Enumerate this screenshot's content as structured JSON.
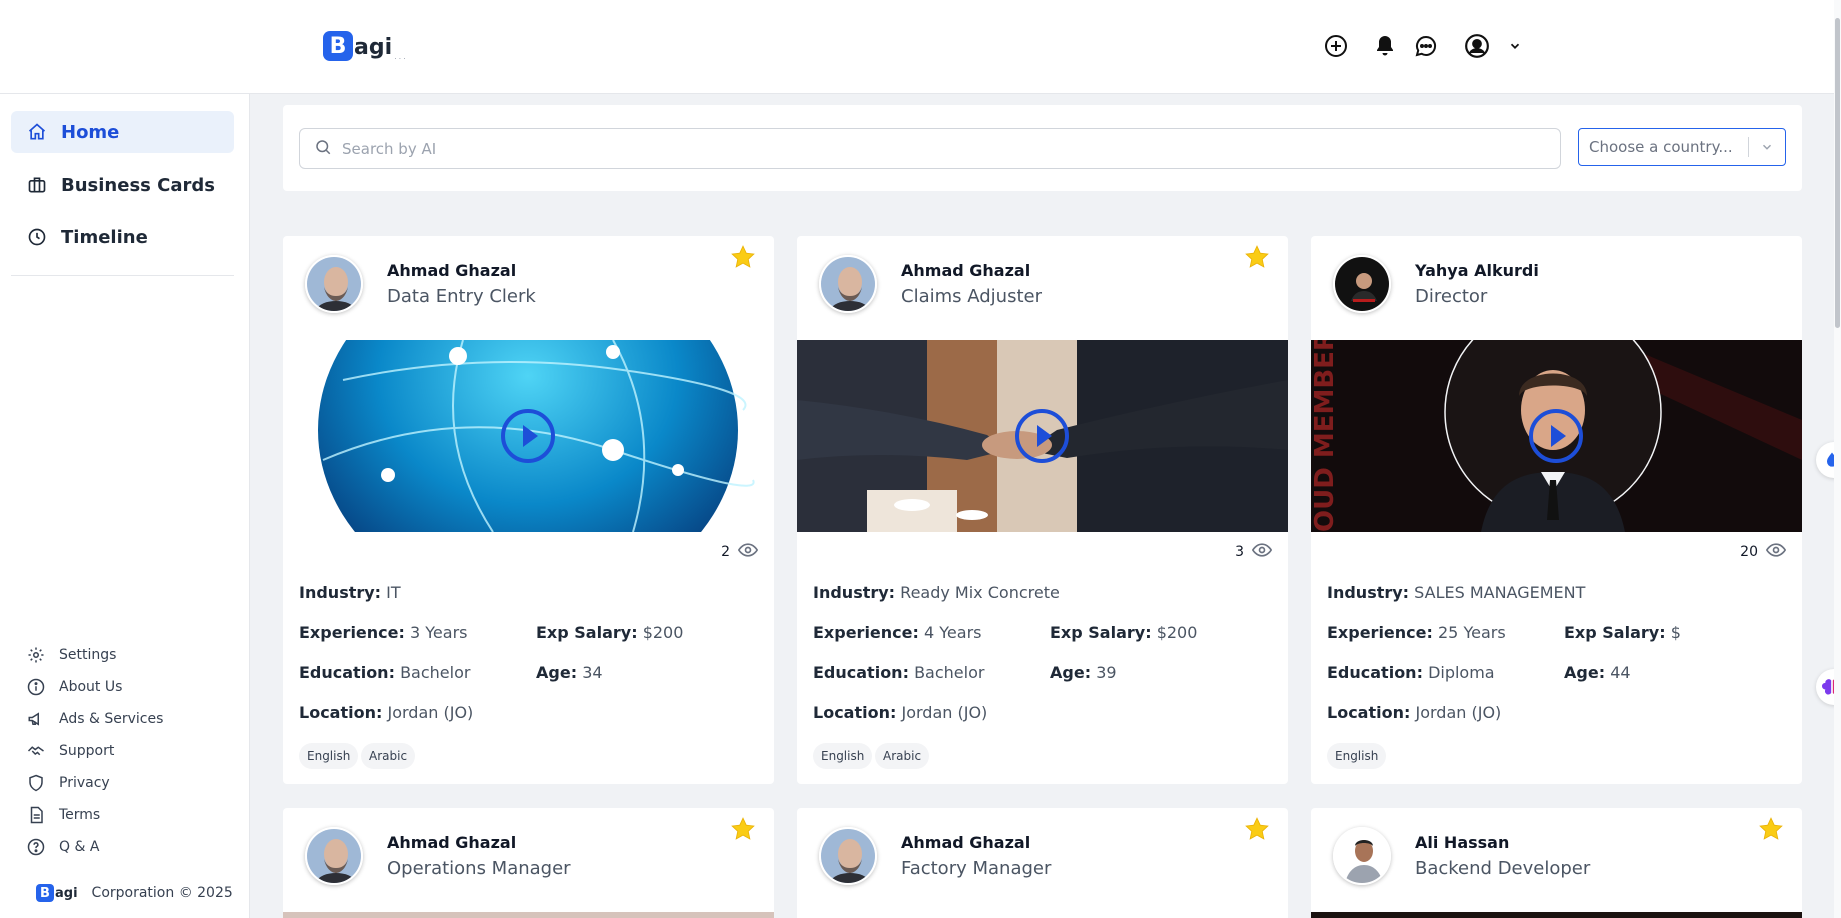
{
  "header": {
    "logo_initial": "B",
    "logo_rest": "agi",
    "logo_dots": "...",
    "icons": [
      "plus-circle-icon",
      "bell-icon",
      "chat-icon",
      "user-circle-icon",
      "chevron-down-icon"
    ]
  },
  "sidebar": {
    "nav": [
      {
        "label": "Home",
        "icon": "home-icon",
        "active": true
      },
      {
        "label": "Business Cards",
        "icon": "briefcase-icon",
        "active": false
      },
      {
        "label": "Timeline",
        "icon": "clock-icon",
        "active": false
      }
    ],
    "footer_links": [
      {
        "label": "Settings",
        "icon": "gear-icon"
      },
      {
        "label": "About Us",
        "icon": "info-icon"
      },
      {
        "label": "Ads & Services",
        "icon": "megaphone-icon"
      },
      {
        "label": "Support",
        "icon": "handshake-icon"
      },
      {
        "label": "Privacy",
        "icon": "shield-icon"
      },
      {
        "label": "Terms",
        "icon": "document-icon"
      },
      {
        "label": "Q & A",
        "icon": "question-icon"
      }
    ],
    "copyright": "Corporation © 2025",
    "mini_logo_initial": "B",
    "mini_logo_rest": "agi"
  },
  "search": {
    "placeholder": "Search by AI",
    "country_placeholder": "Choose a country..."
  },
  "labels": {
    "industry": "Industry:",
    "experience": "Experience:",
    "exp_salary": "Exp Salary:",
    "education": "Education:",
    "age": "Age:",
    "location": "Location:"
  },
  "cards": [
    {
      "name": "Ahmad Ghazal",
      "role": "Data Entry Clerk",
      "views": "2",
      "industry": "IT",
      "experience": "3 Years",
      "salary": "$200",
      "education": "Bachelor",
      "age": "34",
      "location": "Jordan (JO)",
      "languages": [
        "English",
        "Arabic"
      ],
      "starred": true,
      "media": "globe"
    },
    {
      "name": "Ahmad Ghazal",
      "role": "Claims Adjuster",
      "views": "3",
      "industry": "Ready Mix Concrete",
      "experience": "4 Years",
      "salary": "$200",
      "education": "Bachelor",
      "age": "39",
      "location": "Jordan (JO)",
      "languages": [
        "English",
        "Arabic"
      ],
      "starred": true,
      "media": "handshake"
    },
    {
      "name": "Yahya Alkurdi",
      "role": "Director",
      "views": "20",
      "industry": "SALES MANAGEMENT",
      "experience": "25 Years",
      "salary": "$",
      "education": "Diploma",
      "age": "44",
      "location": "Jordan (JO)",
      "languages": [
        "English"
      ],
      "starred": false,
      "media": "portrait"
    },
    {
      "name": "Ahmad Ghazal",
      "role": "Operations Manager",
      "starred": true
    },
    {
      "name": "Ahmad Ghazal",
      "role": "Factory Manager",
      "starred": true
    },
    {
      "name": "Ali Hassan",
      "role": "Backend Developer",
      "starred": true
    }
  ],
  "colors": {
    "accent": "#2563eb",
    "star": "#facc15",
    "play": "#1d4ed8"
  }
}
